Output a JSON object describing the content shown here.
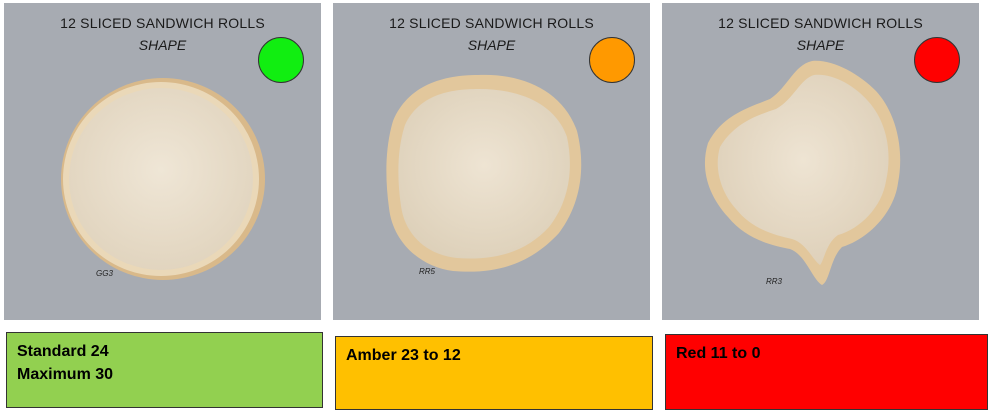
{
  "colors": {
    "panel_bg": "#a7abb2",
    "green_dot": "#11ee11",
    "amber_dot": "#ff9900",
    "red_dot": "#ff0000",
    "green_box": "#92d050",
    "amber_box": "#ffc000",
    "red_box": "#ff0000",
    "crumb": "#e7dccb",
    "crust": "#e8cfa6"
  },
  "panels": [
    {
      "title": "12 SLICED SANDWICH ROLLS",
      "subtitle": "SHAPE",
      "status": "green",
      "status_icon": "green-circle-icon",
      "sample_code": "GG3"
    },
    {
      "title": "12 SLICED SANDWICH ROLLS",
      "subtitle": "SHAPE",
      "status": "amber",
      "status_icon": "amber-circle-icon",
      "sample_code": "RR5"
    },
    {
      "title": "12 SLICED SANDWICH ROLLS",
      "subtitle": "SHAPE",
      "status": "red",
      "status_icon": "red-circle-icon",
      "sample_code": "RR3"
    }
  ],
  "ratings": [
    {
      "lines": [
        "Standard 24",
        "Maximum 30"
      ],
      "color": "#92d050"
    },
    {
      "lines": [
        "Amber 23 to 12"
      ],
      "color": "#ffc000"
    },
    {
      "lines": [
        "Red 11 to 0"
      ],
      "color": "#ff0000"
    }
  ]
}
